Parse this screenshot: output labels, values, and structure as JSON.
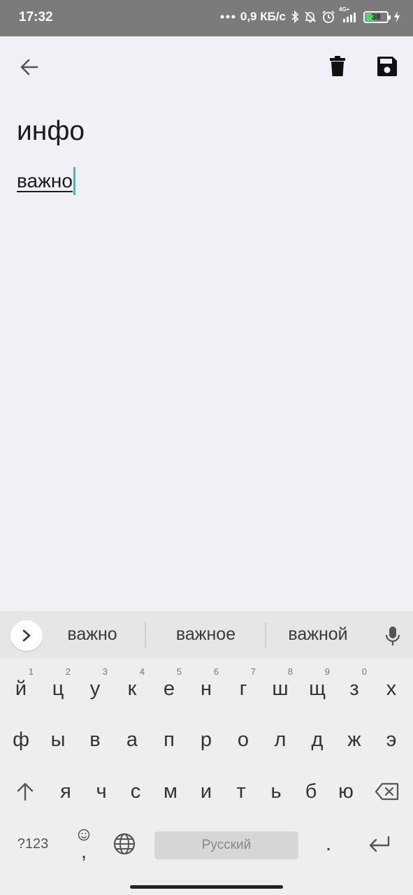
{
  "status_bar": {
    "time": "17:32",
    "network_speed": "0,9 КБ/с",
    "network_type": "4G+",
    "battery_level": "38",
    "icons": [
      "dots-icon",
      "bluetooth-icon",
      "bell-off-icon",
      "alarm-icon",
      "signal-icon",
      "battery-icon",
      "charging-icon"
    ]
  },
  "app_bar": {
    "back_icon": "arrow-left-icon",
    "delete_icon": "trash-icon",
    "save_icon": "floppy-disk-icon"
  },
  "note": {
    "title": "инфо",
    "body": "важно"
  },
  "keyboard": {
    "suggestions": [
      "важно",
      "важное",
      "важной"
    ],
    "row1": [
      {
        "label": "й",
        "hint": "1"
      },
      {
        "label": "ц",
        "hint": "2"
      },
      {
        "label": "у",
        "hint": "3"
      },
      {
        "label": "к",
        "hint": "4"
      },
      {
        "label": "е",
        "hint": "5"
      },
      {
        "label": "н",
        "hint": "6"
      },
      {
        "label": "г",
        "hint": "7"
      },
      {
        "label": "ш",
        "hint": "8"
      },
      {
        "label": "щ",
        "hint": "9"
      },
      {
        "label": "з",
        "hint": "0"
      },
      {
        "label": "х",
        "hint": ""
      }
    ],
    "row2": [
      "ф",
      "ы",
      "в",
      "а",
      "п",
      "р",
      "о",
      "л",
      "д",
      "ж",
      "э"
    ],
    "row3": [
      "я",
      "ч",
      "с",
      "м",
      "и",
      "т",
      "ь",
      "б",
      "ю"
    ],
    "symbols_label": "?123",
    "comma_label": ",",
    "period_label": ".",
    "space_label": "Русский",
    "colors": {
      "accent_caret": "#28c5b4",
      "background": "#f1f0f6",
      "status_bar": "#7b7b7b"
    }
  }
}
